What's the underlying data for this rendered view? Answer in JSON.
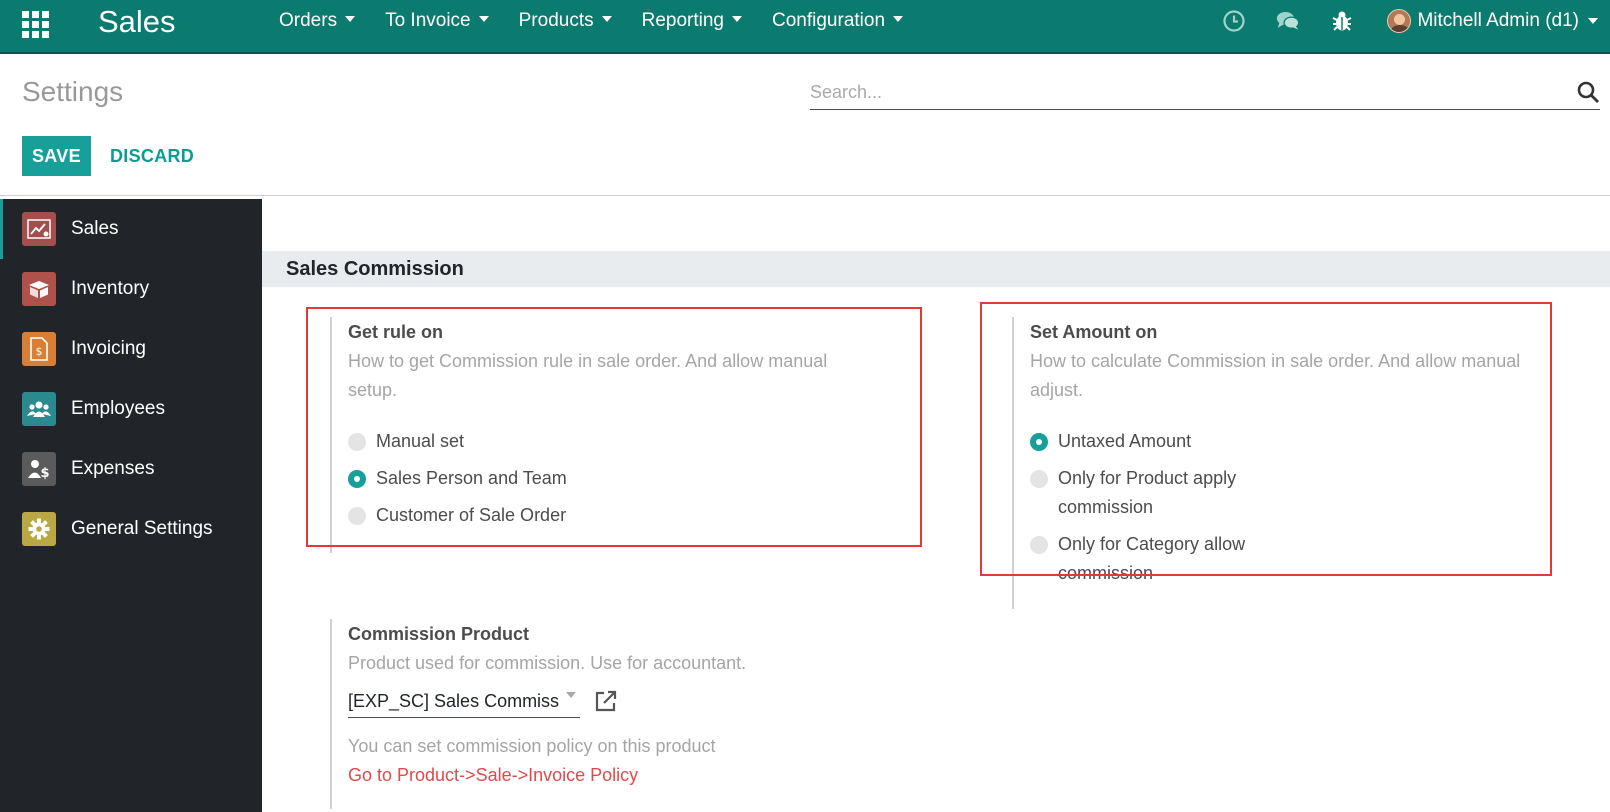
{
  "navbar": {
    "brand": "Sales",
    "menu": [
      "Orders",
      "To Invoice",
      "Products",
      "Reporting",
      "Configuration"
    ],
    "user_name": "Mitchell Admin (d1)",
    "icons": [
      "clock-icon",
      "chat-icon",
      "bug-icon"
    ]
  },
  "control_panel": {
    "title": "Settings",
    "search_placeholder": "Search...",
    "save_label": "SAVE",
    "discard_label": "DISCARD"
  },
  "sidebar": {
    "items": [
      {
        "label": "Sales",
        "icon": "sales-chart-icon",
        "color": "#a24f4d"
      },
      {
        "label": "Inventory",
        "icon": "box-icon",
        "color": "#b0524c"
      },
      {
        "label": "Invoicing",
        "icon": "invoice-icon",
        "color": "#d97e35"
      },
      {
        "label": "Employees",
        "icon": "people-icon",
        "color": "#2a8a8e"
      },
      {
        "label": "Expenses",
        "icon": "expense-user-icon",
        "color": "#5b5b5b"
      },
      {
        "label": "General Settings",
        "icon": "gear-icon",
        "color": "#b9a845"
      }
    ]
  },
  "section": {
    "title": "Sales Commission",
    "rule": {
      "title": "Get rule on",
      "description": "How to get Commission rule in sale order. And allow manual setup.",
      "options": [
        {
          "label": "Manual set",
          "checked": false
        },
        {
          "label": "Sales Person and Team",
          "checked": true
        },
        {
          "label": "Customer of Sale Order",
          "checked": false
        }
      ]
    },
    "amount": {
      "title": "Set Amount on",
      "description": "How to calculate Commission in sale order. And allow manual adjust.",
      "options": [
        {
          "label": "Untaxed Amount",
          "checked": true
        },
        {
          "label": "Only for Product apply commission",
          "checked": false
        },
        {
          "label": "Only for Category allow commission",
          "checked": false
        }
      ]
    },
    "product": {
      "title": "Commission Product",
      "description": "Product used for commission. Use for accountant.",
      "value": "[EXP_SC] Sales Commission",
      "note": "You can set commission policy on this product",
      "link": "Go to Product->Sale->Invoice Policy"
    }
  },
  "colors": {
    "brand": "#0b7a6f",
    "accent": "#17a099",
    "highlight": "#e53935",
    "sidebar": "#212529"
  }
}
